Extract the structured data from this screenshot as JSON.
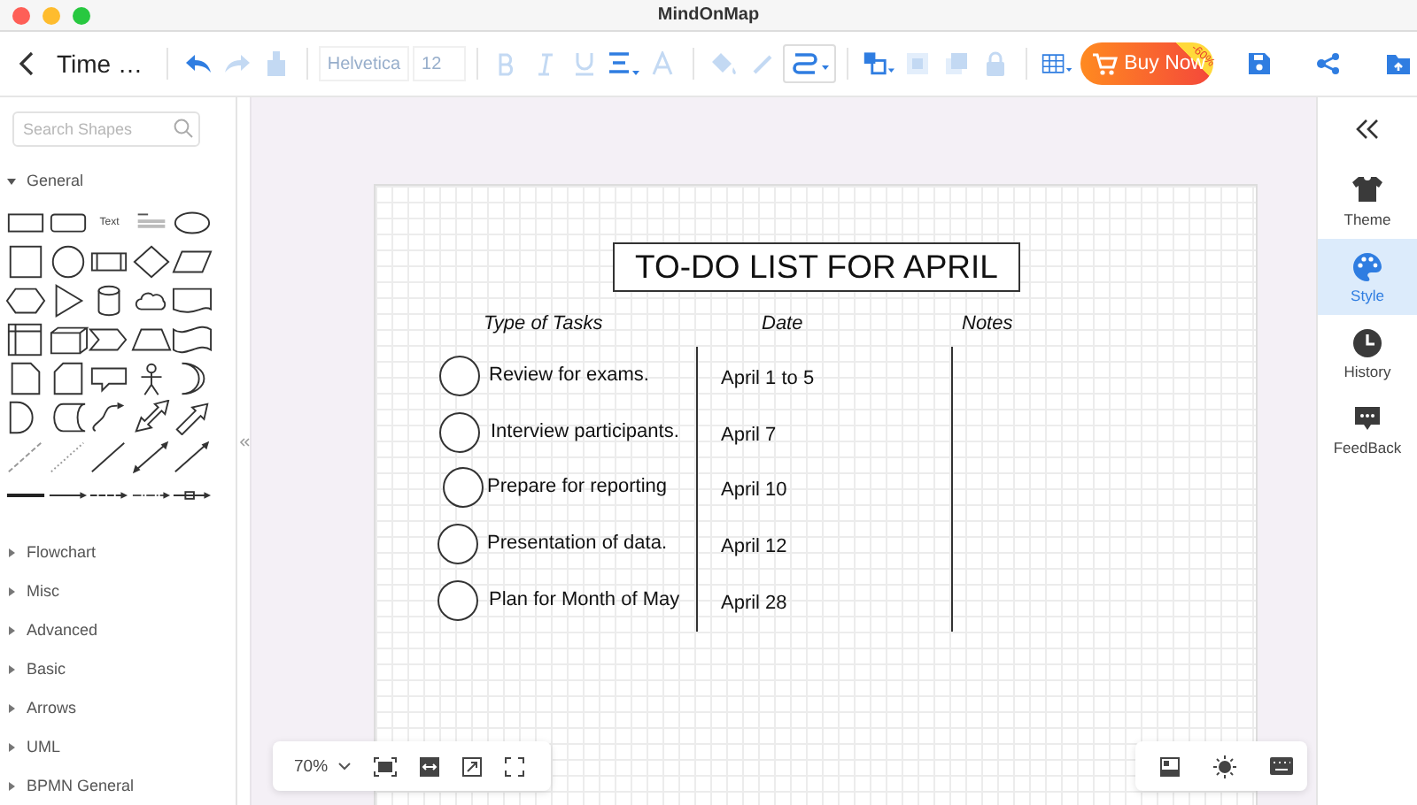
{
  "window": {
    "title": "MindOnMap"
  },
  "toolbar": {
    "document_title": "Time …",
    "font": "Helvetica",
    "font_size": "12",
    "buy_button": {
      "label": "Buy Now",
      "discount": "-60%"
    }
  },
  "sidebar": {
    "search": {
      "placeholder": "Search Shapes"
    },
    "shape_text": "Text",
    "sections": [
      {
        "label": "General",
        "expanded": true
      },
      {
        "label": "Flowchart",
        "expanded": false
      },
      {
        "label": "Misc",
        "expanded": false
      },
      {
        "label": "Advanced",
        "expanded": false
      },
      {
        "label": "Basic",
        "expanded": false
      },
      {
        "label": "Arrows",
        "expanded": false
      },
      {
        "label": "UML",
        "expanded": false
      },
      {
        "label": "BPMN General",
        "expanded": false
      }
    ]
  },
  "canvas": {
    "title": "TO-DO LIST FOR APRIL",
    "columns": [
      "Type of Tasks",
      "Date",
      "Notes"
    ],
    "rows": [
      {
        "task": "Review for exams.",
        "date": "April 1 to 5"
      },
      {
        "task": "Interview participants.",
        "date": "April 7"
      },
      {
        "task": "Prepare for reporting",
        "date": "April 10"
      },
      {
        "task": "Presentation of data.",
        "date": "April 12"
      },
      {
        "task": "Plan for Month of May",
        "date": "April 28"
      }
    ]
  },
  "zoom_bar": {
    "zoom": "70%"
  },
  "right_panel": {
    "items": [
      {
        "kind": "theme",
        "label": "Theme",
        "selected": false
      },
      {
        "kind": "style",
        "label": "Style",
        "selected": true
      },
      {
        "kind": "history",
        "label": "History",
        "selected": false
      },
      {
        "kind": "feedback",
        "label": "FeedBack",
        "selected": false
      }
    ]
  }
}
